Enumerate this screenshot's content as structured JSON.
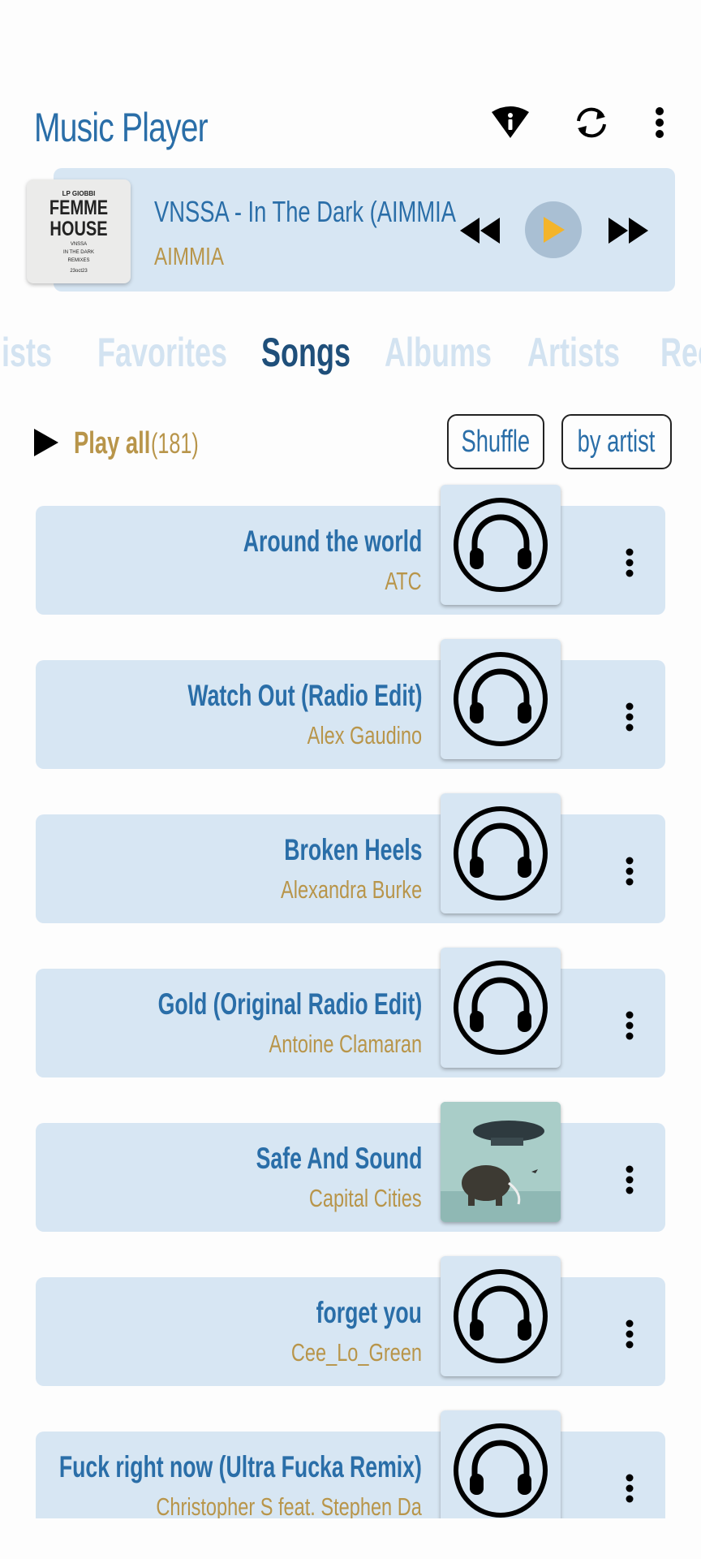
{
  "app": {
    "title": "Music Player"
  },
  "toolbar": {
    "info_icon": "info-icon",
    "sync_icon": "sync-icon",
    "more_icon": "more-vert-icon"
  },
  "now_playing": {
    "title": "VNSSA - In The Dark (AIMMIA",
    "artist": "AIMMIA",
    "cover": {
      "line1": "LP GIOBBI",
      "line2": "FEMME HOUSE",
      "line3": "VNSSA",
      "line4": "IN THE DARK",
      "line5": "REMIXES",
      "line6": "23oct23"
    },
    "accent": "#f4b42a"
  },
  "tabs": [
    "lists",
    "Favorites",
    "Songs",
    "Albums",
    "Artists",
    "Rec"
  ],
  "active_tab": "Songs",
  "actions": {
    "play_all_label": "Play all",
    "play_all_count": "(181)",
    "shuffle_label": "Shuffle",
    "sort_label": "by artist"
  },
  "songs": [
    {
      "title": "Around the world",
      "artist": "ATC",
      "art": "headphones-icon"
    },
    {
      "title": "Watch Out (Radio Edit)",
      "artist": "Alex Gaudino",
      "art": "headphones-icon"
    },
    {
      "title": "Broken Heels",
      "artist": "Alexandra Burke",
      "art": "headphones-icon"
    },
    {
      "title": "Gold (Original Radio Edit)",
      "artist": "Antoine Clamaran",
      "art": "headphones-icon"
    },
    {
      "title": "Safe And Sound",
      "artist": "Capital Cities",
      "art": "album-cover"
    },
    {
      "title": "forget you",
      "artist": "Cee_Lo_Green",
      "art": "headphones-icon"
    },
    {
      "title": "Fuck right now (Ultra Fucka Remix)",
      "artist": "Christopher S feat. Stephen Da",
      "art": "headphones-icon"
    }
  ],
  "colors": {
    "primary": "#2a6ea8",
    "accent_gold": "#b8954a",
    "card_bg": "#d7e6f3",
    "tab_inactive": "#d3e3f1",
    "tab_active": "#1f4f7a"
  }
}
